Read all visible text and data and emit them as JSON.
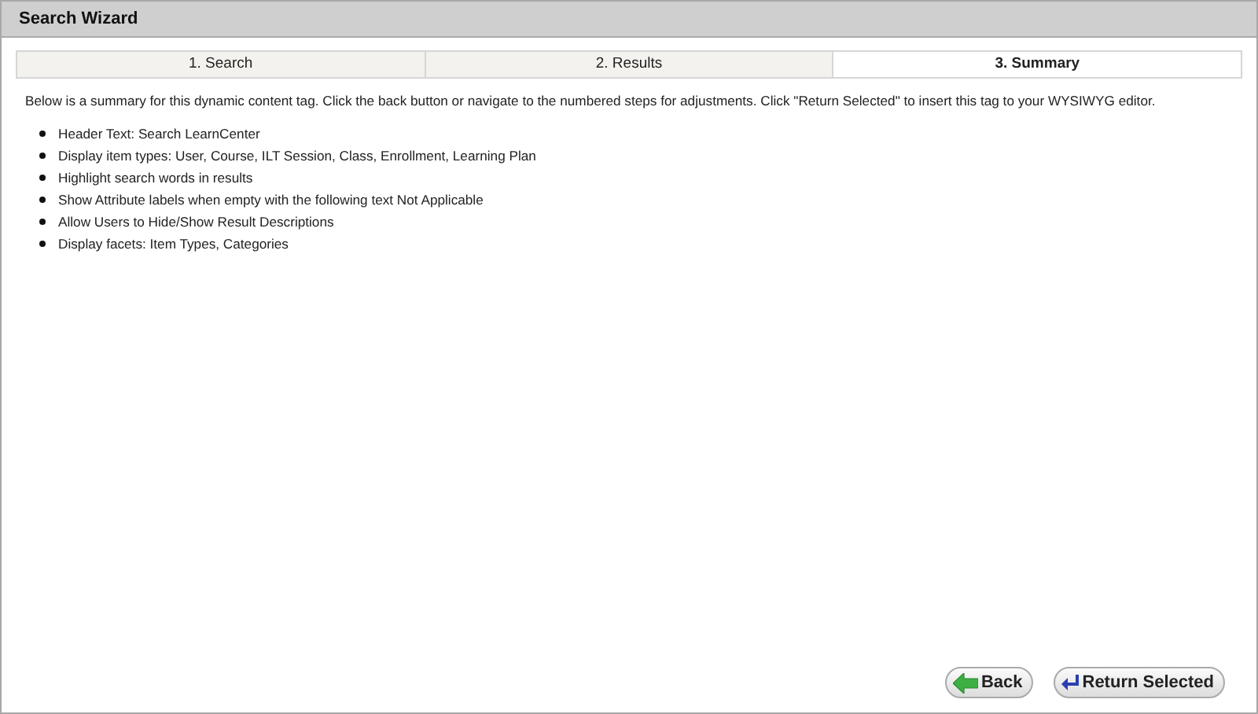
{
  "window": {
    "title": "Search Wizard"
  },
  "steps": [
    {
      "label": "1. Search",
      "selected": false
    },
    {
      "label": "2. Results",
      "selected": false
    },
    {
      "label": "3. Summary",
      "selected": true
    }
  ],
  "intro": "Below is a summary for this dynamic content tag. Click the back button or navigate to the numbered steps for adjustments. Click \"Return Selected\" to insert this tag to your WYSIWYG editor.",
  "summary": [
    "Header Text: Search LearnCenter",
    "Display item types: User, Course, ILT Session, Class, Enrollment, Learning Plan",
    "Highlight search words in results",
    "Show Attribute labels when empty with the following text Not Applicable",
    "Allow Users to Hide/Show Result Descriptions",
    "Display facets: Item Types, Categories"
  ],
  "buttons": [
    {
      "kind": "back",
      "label": "Back"
    },
    {
      "kind": "return",
      "label": "Return Selected"
    }
  ]
}
